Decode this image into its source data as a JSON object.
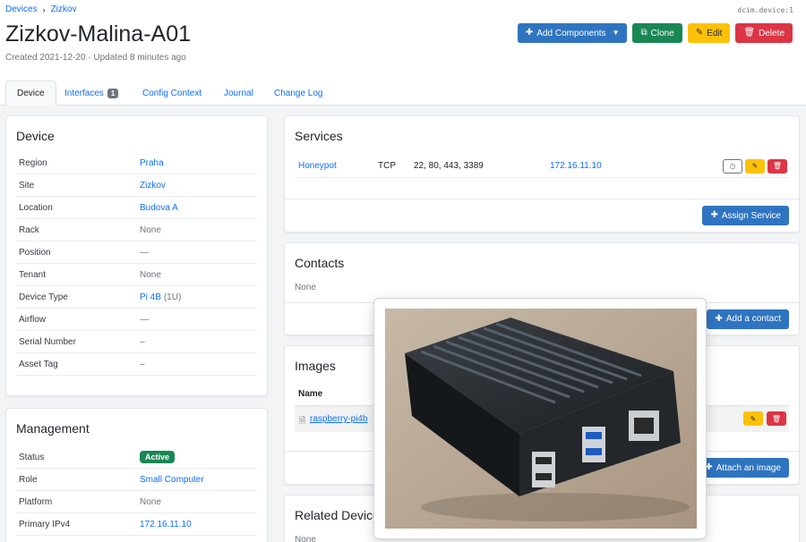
{
  "breadcrumb": {
    "devices": "Devices",
    "sep": "›",
    "site": "Zizkov"
  },
  "object_id": "dcim.device:1",
  "title": "Zizkov-Malina-A01",
  "meta": "Created 2021-12-20 · Updated 8 minutes ago",
  "actions": {
    "add_components": "Add Components",
    "clone": "Clone",
    "edit": "Edit",
    "delete": "Delete"
  },
  "tabs": [
    {
      "label": "Device"
    },
    {
      "label": "Interfaces",
      "count": "1"
    },
    {
      "label": "Config Context"
    },
    {
      "label": "Journal"
    },
    {
      "label": "Change Log"
    }
  ],
  "device": {
    "title": "Device",
    "rows": [
      {
        "k": "Region",
        "v": "Praha"
      },
      {
        "k": "Site",
        "v": "Zizkov"
      },
      {
        "k": "Location",
        "v": "Budova A"
      },
      {
        "k": "Rack",
        "v": "None"
      },
      {
        "k": "Position",
        "v": "—"
      },
      {
        "k": "Tenant",
        "v": "None"
      },
      {
        "k": "Device Type",
        "v": "Pi 4B",
        "extra": "(1U)"
      },
      {
        "k": "Airflow",
        "v": "—"
      },
      {
        "k": "Serial Number",
        "v": "–"
      },
      {
        "k": "Asset Tag",
        "v": "–"
      }
    ]
  },
  "management": {
    "title": "Management",
    "rows": [
      {
        "k": "Status",
        "v": "Active"
      },
      {
        "k": "Role",
        "v": "Small Computer"
      },
      {
        "k": "Platform",
        "v": "None"
      },
      {
        "k": "Primary IPv4",
        "v": "172.16.11.10"
      }
    ]
  },
  "services": {
    "title": "Services",
    "row": {
      "name": "Honeypot",
      "protocol": "TCP",
      "ports": "22, 80, 443, 3389",
      "ip": "172.16.11.10"
    },
    "assign_label": "Assign Service"
  },
  "contacts": {
    "title": "Contacts",
    "empty": "None",
    "add_label": "Add a contact"
  },
  "images": {
    "title": "Images",
    "col_name": "Name",
    "file": "raspberry-pi4b",
    "attach_label": "Attach an image"
  },
  "related": {
    "title": "Related Devices",
    "empty": "None"
  },
  "colors": {
    "primary": "#2f74c0",
    "success": "#198754",
    "warning": "#ffc107",
    "danger": "#dc3545",
    "link": "#0d6efd"
  }
}
